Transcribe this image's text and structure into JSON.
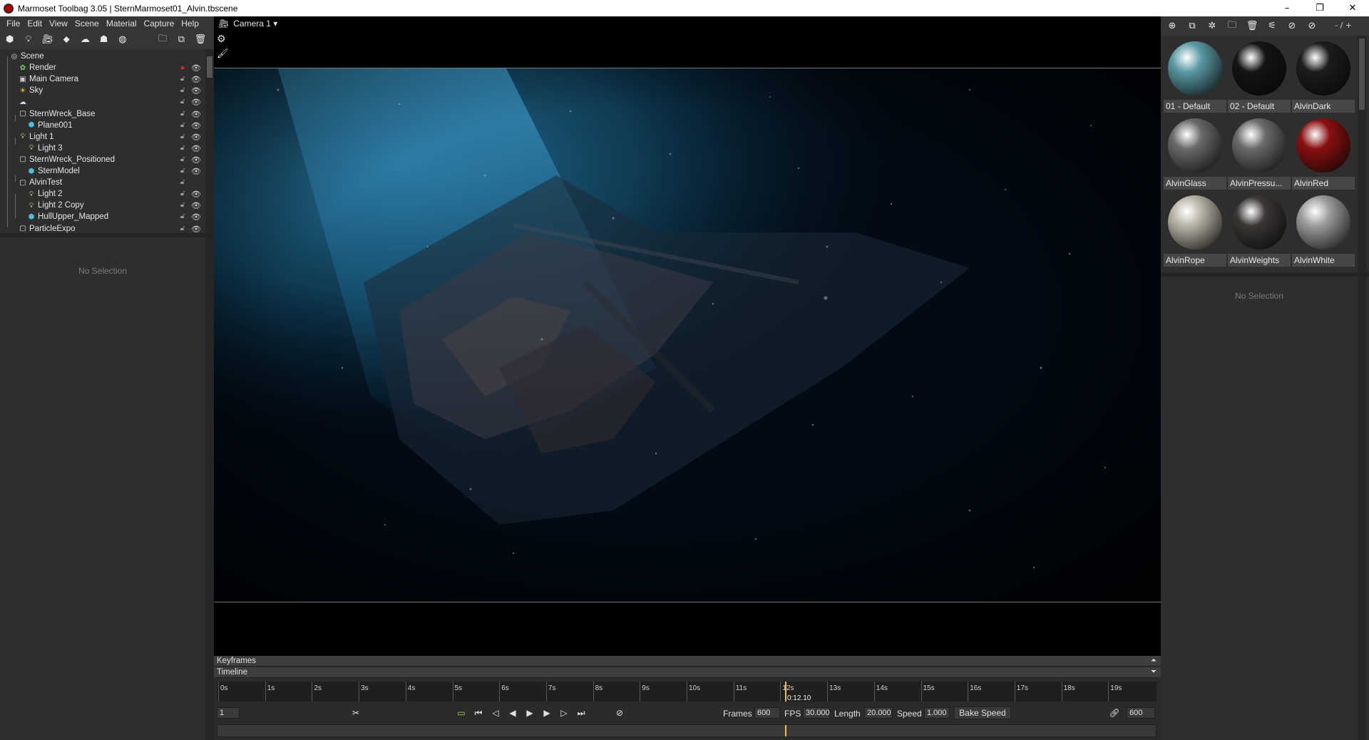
{
  "window": {
    "title": "Marmoset Toolbag 3.05  |  SternMarmoset01_Alvin.tbscene",
    "controls": [
      "–",
      "❐",
      "✕"
    ]
  },
  "menu": [
    "File",
    "Edit",
    "View",
    "Scene",
    "Material",
    "Capture",
    "Help"
  ],
  "left_toolbar_icons": [
    "cube-add-icon",
    "light-add-icon",
    "camera-add-icon",
    "plane-add-icon",
    "fog-add-icon",
    "shadow-catcher-icon",
    "sky-icon",
    "folder-icon",
    "duplicate-icon",
    "trash-icon"
  ],
  "scene_tree": [
    {
      "label": "Scene",
      "icon": "scene-icon",
      "depth": 0,
      "locked": false
    },
    {
      "label": "Render",
      "icon": "render-icon",
      "depth": 1,
      "locked": true
    },
    {
      "label": "Main Camera",
      "icon": "camera-icon",
      "depth": 1,
      "locked": false
    },
    {
      "label": "Sky",
      "icon": "sky-icon",
      "depth": 1,
      "locked": false
    },
    {
      "label": "",
      "icon": "fog-icon",
      "depth": 1,
      "locked": false
    },
    {
      "label": "SternWreck_Base",
      "icon": "object-icon",
      "depth": 1,
      "locked": false
    },
    {
      "label": "Plane001",
      "icon": "mesh-icon",
      "depth": 2,
      "locked": false
    },
    {
      "label": "Light 1",
      "icon": "light-icon",
      "depth": 1,
      "locked": false
    },
    {
      "label": "Light 3",
      "icon": "light-icon",
      "depth": 2,
      "locked": false
    },
    {
      "label": "SternWreck_Positioned",
      "icon": "object-icon",
      "depth": 1,
      "locked": false
    },
    {
      "label": "SternModel",
      "icon": "mesh-icon",
      "depth": 2,
      "locked": false
    },
    {
      "label": "AlvinTest",
      "icon": "object-icon",
      "depth": 1,
      "locked": false
    },
    {
      "label": "Light 2",
      "icon": "light-icon",
      "depth": 2,
      "locked": false
    },
    {
      "label": "Light 2 Copy",
      "icon": "light-icon",
      "depth": 2,
      "locked": false
    },
    {
      "label": "HullUpper_Mapped",
      "icon": "mesh-icon",
      "depth": 2,
      "locked": false
    },
    {
      "label": "ParticleExpo",
      "icon": "object-icon",
      "depth": 1,
      "locked": false
    }
  ],
  "left_props": {
    "no_selection": "No Selection"
  },
  "viewport": {
    "camera_label": "Camera 1 ▾"
  },
  "right_toolbar": {
    "icons": [
      "add-material-icon",
      "duplicate-material-icon",
      "material-settings-icon",
      "folder-icon",
      "trash-icon",
      "pick-material-icon",
      "eyedropper-icon",
      "navigate-icon"
    ],
    "page": "- / +"
  },
  "materials": [
    {
      "name": "01 - Default",
      "color": "#5a9aa4"
    },
    {
      "name": "02 - Default",
      "color": "#141414"
    },
    {
      "name": "AlvinDark",
      "color": "#1c1c1c"
    },
    {
      "name": "AlvinGlass",
      "color": "#6a6a6a"
    },
    {
      "name": "AlvinPressu...",
      "color": "#6a6a6a"
    },
    {
      "name": "AlvinRed",
      "color": "#8a1010"
    },
    {
      "name": "AlvinRope",
      "color": "#b8b4a6"
    },
    {
      "name": "AlvinWeights",
      "color": "#3a3734"
    },
    {
      "name": "AlvinWhite",
      "color": "#9c9c9c"
    }
  ],
  "right_props": {
    "no_selection": "No Selection"
  },
  "timeline": {
    "keyframes_label": "Keyframes",
    "timeline_label": "Timeline",
    "ticks": [
      "0s",
      "1s",
      "2s",
      "3s",
      "4s",
      "5s",
      "6s",
      "7s",
      "8s",
      "9s",
      "10s",
      "11s",
      "12s",
      "13s",
      "14s",
      "15s",
      "16s",
      "17s",
      "18s",
      "19s"
    ],
    "current_time": "0:12.10",
    "current_seconds": 12.1,
    "length_seconds": 20,
    "frame_field": "1",
    "frames_label": "Frames",
    "frames_value": "600",
    "fps_label": "FPS",
    "fps_value": "30.000",
    "length_label": "Length",
    "length_value": "20.000",
    "speed_label": "Speed",
    "speed_value": "1.000",
    "bake_label": "Bake Speed",
    "end_frame": "600"
  },
  "colors": {
    "accent_playhead": "#f0c040",
    "panel_bg": "#2e2e2e",
    "toolbar_bg": "#363636",
    "light_beam": "#1d6f98"
  }
}
